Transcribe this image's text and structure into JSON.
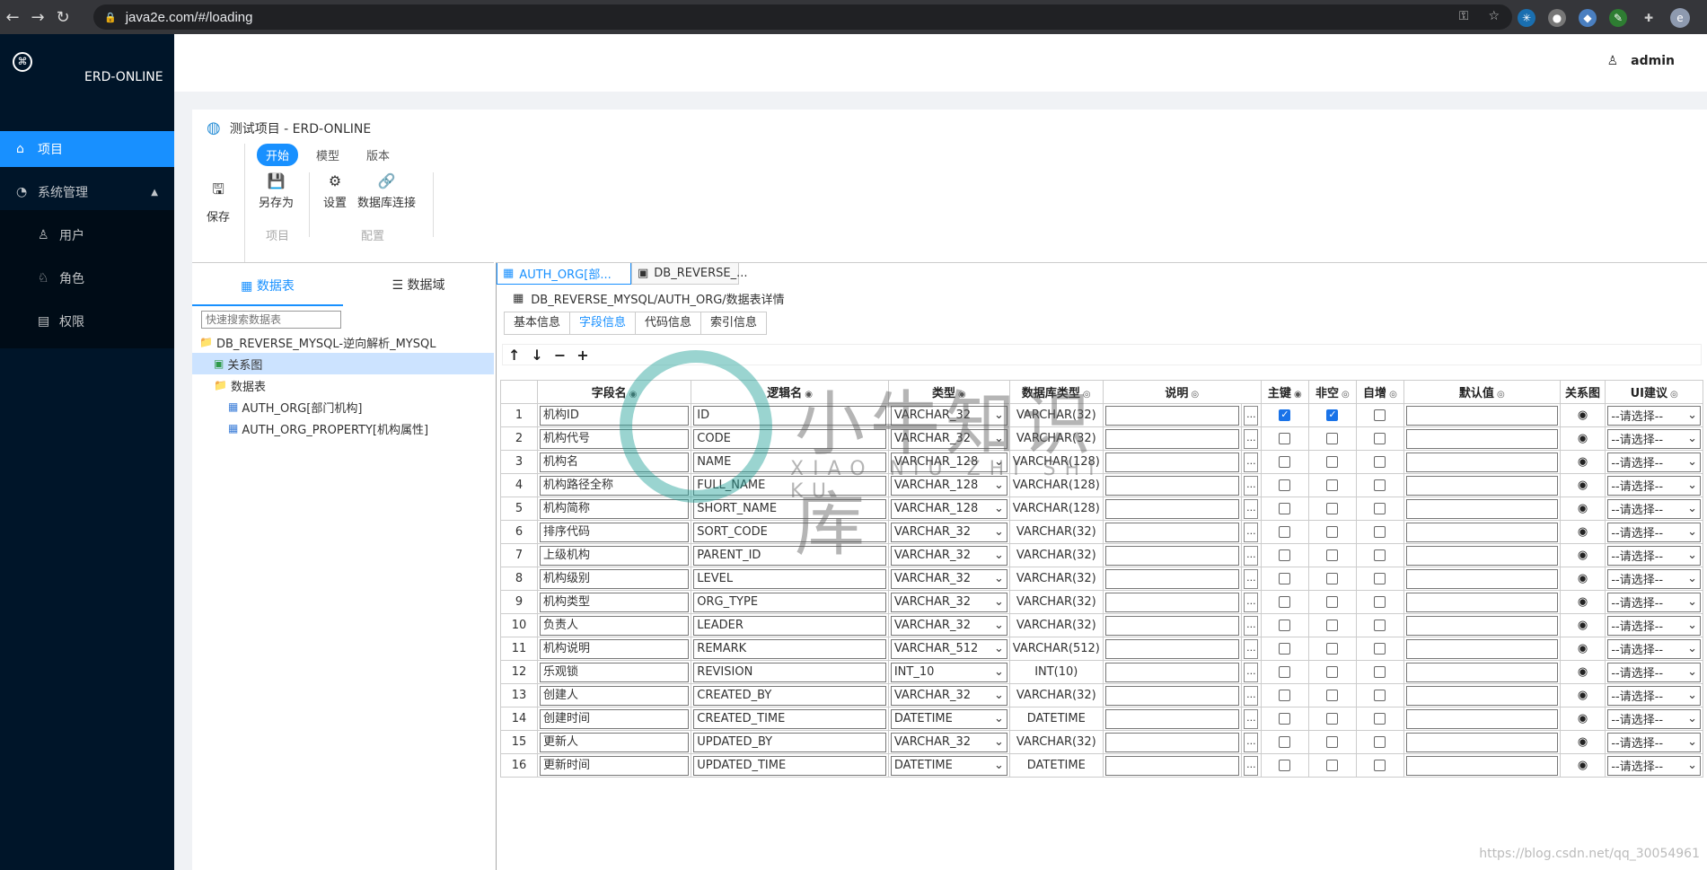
{
  "browser": {
    "url": "java2e.com/#/loading",
    "profile_initial": "e"
  },
  "sidebar": {
    "app_name": "ERD-ONLINE",
    "menu": [
      {
        "label": "项目",
        "icon": "home-icon",
        "active": true
      },
      {
        "label": "系统管理",
        "icon": "pie-chart-icon",
        "expanded": true
      }
    ],
    "sub_items": [
      {
        "label": "用户",
        "icon": "user-icon"
      },
      {
        "label": "角色",
        "icon": "role-icon"
      },
      {
        "label": "权限",
        "icon": "permission-icon"
      }
    ]
  },
  "header": {
    "username": "admin"
  },
  "project": {
    "title": "测试项目 - ERD-ONLINE",
    "ribbon_tabs": [
      "开始",
      "模型",
      "版本"
    ],
    "buttons": {
      "save": "保存",
      "save_as": "另存为",
      "settings": "设置",
      "db_connect": "数据库连接"
    },
    "group_labels": {
      "project": "项目",
      "config": "配置"
    }
  },
  "tree": {
    "tabs": [
      "数据表",
      "数据域"
    ],
    "search_placeholder": "快速搜索数据表",
    "nodes": [
      {
        "label": "DB_REVERSE_MYSQL-逆向解析_MYSQL",
        "level": 0,
        "icon": "folder-icon"
      },
      {
        "label": "关系图",
        "level": 1,
        "icon": "diagram-icon",
        "selected": true
      },
      {
        "label": "数据表",
        "level": 1,
        "icon": "folder-icon"
      },
      {
        "label": "AUTH_ORG[部门机构]",
        "level": 2,
        "icon": "table-icon"
      },
      {
        "label": "AUTH_ORG_PROPERTY[机构属性]",
        "level": 2,
        "icon": "table-icon"
      }
    ]
  },
  "editor": {
    "doc_tabs": [
      "AUTH_ORG[部...",
      "DB_REVERSE_..."
    ],
    "path": "DB_REVERSE_MYSQL/AUTH_ORG/数据表详情",
    "sub_tabs": [
      "基本信息",
      "字段信息",
      "代码信息",
      "索引信息"
    ],
    "active_sub_tab": 1,
    "toolbar": [
      "↑",
      "↓",
      "−",
      "+"
    ],
    "columns": [
      "",
      "字段名",
      "逻辑名",
      "类型",
      "数据库类型",
      "说明",
      "",
      "主键",
      "非空",
      "自增",
      "默认值",
      "关系图",
      "UI建议"
    ],
    "ui_placeholder": "--请选择--",
    "rows": [
      {
        "n": "1",
        "name": "机构ID",
        "logic": "ID",
        "type": "VARCHAR_32",
        "db": "VARCHAR(32)",
        "pk": true,
        "nn": true,
        "ai": false
      },
      {
        "n": "2",
        "name": "机构代号",
        "logic": "CODE",
        "type": "VARCHAR_32",
        "db": "VARCHAR(32)",
        "pk": false,
        "nn": false,
        "ai": false
      },
      {
        "n": "3",
        "name": "机构名",
        "logic": "NAME",
        "type": "VARCHAR_128",
        "db": "VARCHAR(128)",
        "pk": false,
        "nn": false,
        "ai": false
      },
      {
        "n": "4",
        "name": "机构路径全称",
        "logic": "FULL_NAME",
        "type": "VARCHAR_128",
        "db": "VARCHAR(128)",
        "pk": false,
        "nn": false,
        "ai": false
      },
      {
        "n": "5",
        "name": "机构简称",
        "logic": "SHORT_NAME",
        "type": "VARCHAR_128",
        "db": "VARCHAR(128)",
        "pk": false,
        "nn": false,
        "ai": false
      },
      {
        "n": "6",
        "name": "排序代码",
        "logic": "SORT_CODE",
        "type": "VARCHAR_32",
        "db": "VARCHAR(32)",
        "pk": false,
        "nn": false,
        "ai": false
      },
      {
        "n": "7",
        "name": "上级机构",
        "logic": "PARENT_ID",
        "type": "VARCHAR_32",
        "db": "VARCHAR(32)",
        "pk": false,
        "nn": false,
        "ai": false
      },
      {
        "n": "8",
        "name": "机构级别",
        "logic": "LEVEL",
        "type": "VARCHAR_32",
        "db": "VARCHAR(32)",
        "pk": false,
        "nn": false,
        "ai": false
      },
      {
        "n": "9",
        "name": "机构类型",
        "logic": "ORG_TYPE",
        "type": "VARCHAR_32",
        "db": "VARCHAR(32)",
        "pk": false,
        "nn": false,
        "ai": false
      },
      {
        "n": "10",
        "name": "负责人",
        "logic": "LEADER",
        "type": "VARCHAR_32",
        "db": "VARCHAR(32)",
        "pk": false,
        "nn": false,
        "ai": false
      },
      {
        "n": "11",
        "name": "机构说明",
        "logic": "REMARK",
        "type": "VARCHAR_512",
        "db": "VARCHAR(512)",
        "pk": false,
        "nn": false,
        "ai": false
      },
      {
        "n": "12",
        "name": "乐观锁",
        "logic": "REVISION",
        "type": "INT_10",
        "db": "INT(10)",
        "pk": false,
        "nn": false,
        "ai": false
      },
      {
        "n": "13",
        "name": "创建人",
        "logic": "CREATED_BY",
        "type": "VARCHAR_32",
        "db": "VARCHAR(32)",
        "pk": false,
        "nn": false,
        "ai": false
      },
      {
        "n": "14",
        "name": "创建时间",
        "logic": "CREATED_TIME",
        "type": "DATETIME",
        "db": "DATETIME",
        "pk": false,
        "nn": false,
        "ai": false
      },
      {
        "n": "15",
        "name": "更新人",
        "logic": "UPDATED_BY",
        "type": "VARCHAR_32",
        "db": "VARCHAR(32)",
        "pk": false,
        "nn": false,
        "ai": false
      },
      {
        "n": "16",
        "name": "更新时间",
        "logic": "UPDATED_TIME",
        "type": "DATETIME",
        "db": "DATETIME",
        "pk": false,
        "nn": false,
        "ai": false
      }
    ]
  },
  "watermark": {
    "cn": "小牛知识库",
    "en": "XIAO NIU ZHI SHI KU"
  },
  "footer_credit": "https://blog.csdn.net/qq_30054961"
}
